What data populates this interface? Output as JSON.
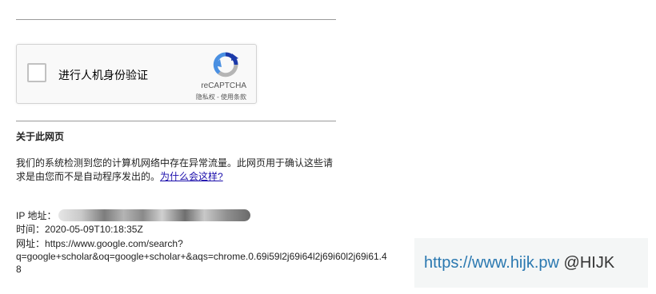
{
  "captcha": {
    "label": "进行人机身份验证",
    "brand": "reCAPTCHA",
    "privacy": "隐私权",
    "separator": " - ",
    "terms": "使用条款",
    "colors": {
      "logo_blue": "#4a90e2",
      "logo_gray": "#b5b5b5",
      "logo_dark": "#1c3aa9"
    }
  },
  "about": {
    "heading": "关于此网页",
    "body": "我们的系统检测到您的计算机网络中存在异常流量。此网页用于确认这些请求是由您而不是自动程序发出的。",
    "link": "为什么会这样?"
  },
  "details": {
    "ip_label": "IP 地址：",
    "time_label": "时间：",
    "time_value": "2020-05-09T10:18:35Z",
    "url_label": "网址：",
    "url_value": "https://www.google.com/search?",
    "url_line2": "q=google+scholar&oq=google+scholar+&aqs=chrome.0.69i59l2j69i64l2j69i60l2j69i61.4",
    "url_line3": "8"
  },
  "watermark": {
    "url": "https://www.hijk.pw",
    "handle": "@HIJK"
  }
}
